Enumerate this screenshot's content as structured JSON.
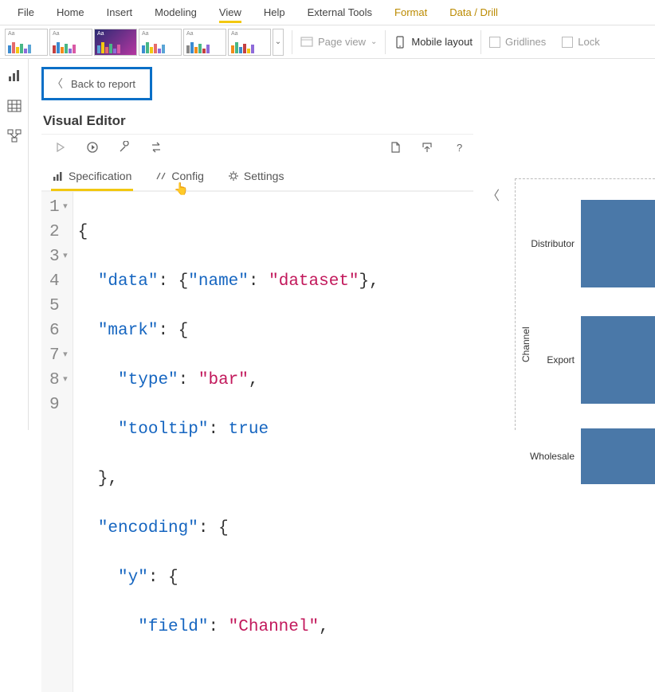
{
  "menu": {
    "file": "File",
    "home": "Home",
    "insert": "Insert",
    "modeling": "Modeling",
    "view": "View",
    "help": "Help",
    "external": "External Tools",
    "format": "Format",
    "datadrill": "Data / Drill"
  },
  "ribbon": {
    "page_view": "Page view",
    "mobile_layout": "Mobile layout",
    "gridlines": "Gridlines",
    "lock": "Lock"
  },
  "main": {
    "back": "Back to report",
    "visual_editor": "Visual Editor"
  },
  "tabs": {
    "specification": "Specification",
    "config": "Config",
    "settings": "Settings"
  },
  "code": {
    "lines": {
      "l1": "{",
      "l2a": "\"data\"",
      "l2b": ": {",
      "l2c": "\"name\"",
      "l2d": ": ",
      "l2e": "\"dataset\"",
      "l2f": "},",
      "l3a": "\"mark\"",
      "l3b": ": {",
      "l4a": "\"type\"",
      "l4b": ": ",
      "l4c": "\"bar\"",
      "l4d": ",",
      "l5a": "\"tooltip\"",
      "l5b": ": ",
      "l5c": "true",
      "l6": "},",
      "l7a": "\"encoding\"",
      "l7b": ": {",
      "l8a": "\"y\"",
      "l8b": ": {",
      "l9a": "\"field\"",
      "l9b": ": ",
      "l9c": "\"Channel\"",
      "l9d": ","
    },
    "line_numbers": [
      "1",
      "2",
      "3",
      "4",
      "5",
      "6",
      "7",
      "8",
      "9"
    ]
  },
  "chart_data": {
    "type": "bar",
    "orientation": "horizontal",
    "ylabel": "Channel",
    "categories": [
      "Distributor",
      "Export",
      "Wholesale"
    ],
    "values": [
      1,
      1,
      1
    ],
    "bar_color": "#4a78a8"
  }
}
